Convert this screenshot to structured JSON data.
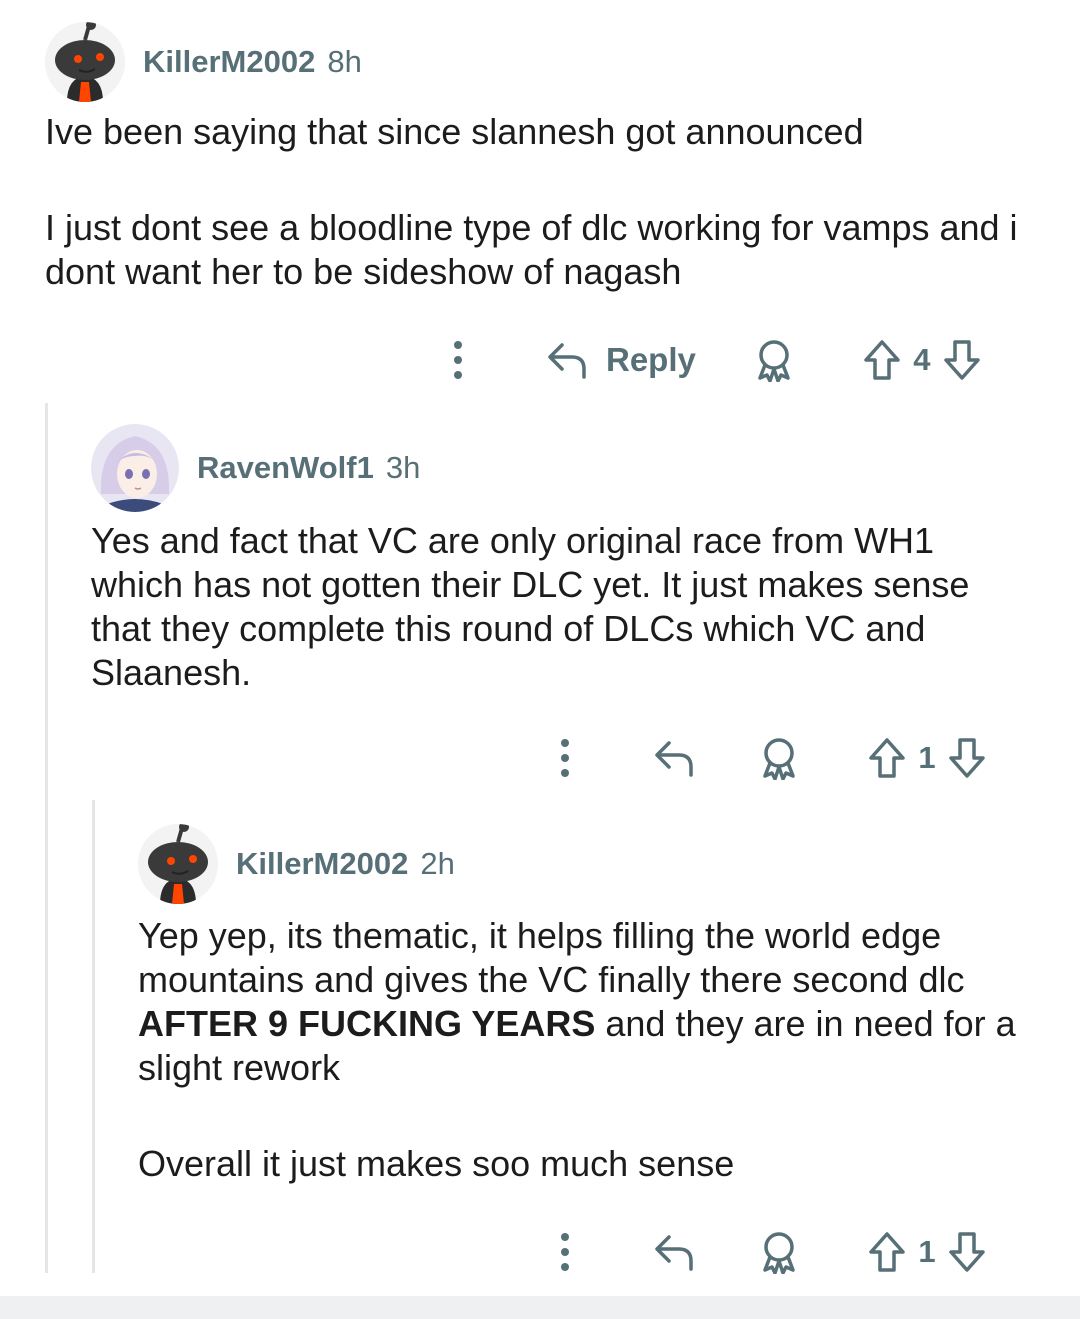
{
  "comments": [
    {
      "username": "KillerM2002",
      "age": "8h",
      "paragraphs": [
        "Ive been saying that since slannesh got announced",
        "I just dont see a bloodline type of dlc working for vamps and i dont want her to be sideshow of nagash"
      ],
      "reply_label": "Reply",
      "votes": "4",
      "avatar": "snoo-avatar-dark"
    },
    {
      "username": "RavenWolf1",
      "age": "3h",
      "paragraphs": [
        "Yes and fact that VC are only original race from WH1 which has not gotten their DLC yet. It just makes sense that they complete this round of DLCs which VC and Slaanesh."
      ],
      "votes": "1",
      "avatar": "anime-girl-avatar"
    },
    {
      "username": "KillerM2002",
      "age": "2h",
      "text_before_bold": "Yep yep, its thematic, it helps filling the world edge mountains and gives the VC finally there second dlc ",
      "bold_text": "AFTER 9 FUCKING YEARS",
      "text_after_bold": " and they are in need for a slight rework",
      "paragraph2": "Overall it just makes soo much sense",
      "votes": "1",
      "avatar": "snoo-avatar-dark"
    }
  ],
  "icons": {
    "more": "more-options-icon",
    "reply": "reply-arrow-icon",
    "award": "award-icon",
    "upvote": "upvote-arrow-icon",
    "downvote": "downvote-arrow-icon"
  },
  "colors": {
    "meta_text": "#576f76",
    "body_text": "#1c1c1c",
    "thread_line": "#e4e6e8",
    "snoo_eye": "#ff4500"
  }
}
